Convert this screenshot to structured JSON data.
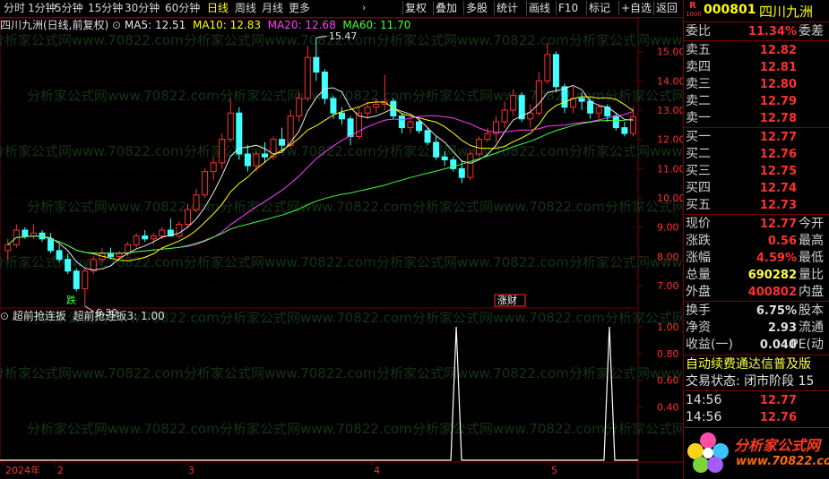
{
  "toolbar": {
    "periods": [
      "分时",
      "1分钟",
      "5分钟",
      "15分钟",
      "30分钟",
      "60分钟",
      "日线",
      "周线",
      "月线",
      "更多"
    ],
    "active_period": "日线",
    "right_buttons": [
      "复权",
      "叠加",
      "多股",
      "统计",
      "画线",
      "F10",
      "标记",
      "+自选",
      "返回"
    ]
  },
  "main": {
    "title": "四川九洲(日线,前复权)",
    "ma5": "MA5: 12.51",
    "ma10": "MA10: 12.83",
    "ma20": "MA20: 12.68",
    "ma60": "MA60: 11.70",
    "high_label": "15.47",
    "low_label": "6.30",
    "tag_die": "跌",
    "tag_zhangcai": "涨财",
    "y_ticks": [
      "15.00",
      "14.00",
      "13.00",
      "12.00",
      "11.00",
      "10.00",
      "9.00",
      "8.00",
      "7.00"
    ],
    "x_labels": [
      "2024年",
      "2",
      "3",
      "4",
      "5"
    ]
  },
  "indicator": {
    "name": "超前抢连扳",
    "value_label": "超前抢连扳3: 1.00",
    "y_ticks": [
      "1.00",
      "0.80",
      "0.60",
      "0.40"
    ]
  },
  "chart_data": [
    {
      "type": "candlestick",
      "title": "四川九洲(日线,前复权)",
      "ylim": [
        6.3,
        15.6
      ],
      "x_labels": [
        "2024年",
        "2",
        "3",
        "4",
        "5"
      ],
      "candles": [
        {
          "o": 8.2,
          "h": 8.6,
          "l": 7.9,
          "c": 8.4
        },
        {
          "o": 8.4,
          "h": 9.1,
          "l": 8.3,
          "c": 8.9
        },
        {
          "o": 8.9,
          "h": 9.0,
          "l": 8.6,
          "c": 8.7
        },
        {
          "o": 8.7,
          "h": 9.1,
          "l": 8.6,
          "c": 8.8
        },
        {
          "o": 8.8,
          "h": 8.9,
          "l": 8.5,
          "c": 8.6
        },
        {
          "o": 8.6,
          "h": 8.8,
          "l": 8.1,
          "c": 8.2
        },
        {
          "o": 8.2,
          "h": 8.4,
          "l": 7.8,
          "c": 7.9
        },
        {
          "o": 7.9,
          "h": 8.1,
          "l": 7.4,
          "c": 7.5
        },
        {
          "o": 7.5,
          "h": 7.6,
          "l": 6.8,
          "c": 6.9
        },
        {
          "o": 6.9,
          "h": 7.6,
          "l": 6.3,
          "c": 7.5
        },
        {
          "o": 7.5,
          "h": 8.0,
          "l": 7.4,
          "c": 7.9
        },
        {
          "o": 7.9,
          "h": 8.3,
          "l": 7.8,
          "c": 8.1
        },
        {
          "o": 8.1,
          "h": 8.3,
          "l": 7.9,
          "c": 8.0
        },
        {
          "o": 8.0,
          "h": 8.2,
          "l": 7.9,
          "c": 8.1
        },
        {
          "o": 8.1,
          "h": 8.5,
          "l": 8.0,
          "c": 8.4
        },
        {
          "o": 8.4,
          "h": 8.8,
          "l": 8.3,
          "c": 8.7
        },
        {
          "o": 8.7,
          "h": 8.9,
          "l": 8.5,
          "c": 8.6
        },
        {
          "o": 8.6,
          "h": 8.8,
          "l": 8.4,
          "c": 8.7
        },
        {
          "o": 8.7,
          "h": 9.0,
          "l": 8.6,
          "c": 8.9
        },
        {
          "o": 8.9,
          "h": 9.3,
          "l": 8.8,
          "c": 8.7
        },
        {
          "o": 8.7,
          "h": 9.2,
          "l": 8.6,
          "c": 9.1
        },
        {
          "o": 9.1,
          "h": 9.8,
          "l": 9.0,
          "c": 9.6
        },
        {
          "o": 9.6,
          "h": 10.3,
          "l": 9.5,
          "c": 10.1
        },
        {
          "o": 10.1,
          "h": 11.0,
          "l": 10.0,
          "c": 10.9
        },
        {
          "o": 10.9,
          "h": 11.4,
          "l": 10.6,
          "c": 11.2
        },
        {
          "o": 11.2,
          "h": 12.2,
          "l": 11.0,
          "c": 12.0
        },
        {
          "o": 12.0,
          "h": 13.4,
          "l": 11.9,
          "c": 12.9
        },
        {
          "o": 12.9,
          "h": 13.1,
          "l": 11.3,
          "c": 11.5
        },
        {
          "o": 11.5,
          "h": 11.8,
          "l": 10.9,
          "c": 11.1
        },
        {
          "o": 11.1,
          "h": 11.6,
          "l": 10.9,
          "c": 11.5
        },
        {
          "o": 11.5,
          "h": 11.9,
          "l": 11.2,
          "c": 11.4
        },
        {
          "o": 11.4,
          "h": 12.1,
          "l": 11.3,
          "c": 12.0
        },
        {
          "o": 12.0,
          "h": 12.4,
          "l": 11.6,
          "c": 11.8
        },
        {
          "o": 11.8,
          "h": 13.0,
          "l": 11.7,
          "c": 12.8
        },
        {
          "o": 12.8,
          "h": 13.6,
          "l": 12.6,
          "c": 13.4
        },
        {
          "o": 13.4,
          "h": 15.2,
          "l": 13.3,
          "c": 14.8
        },
        {
          "o": 14.8,
          "h": 15.47,
          "l": 14.0,
          "c": 14.3
        },
        {
          "o": 14.3,
          "h": 14.4,
          "l": 13.2,
          "c": 13.4
        },
        {
          "o": 13.4,
          "h": 13.5,
          "l": 12.7,
          "c": 12.9
        },
        {
          "o": 12.9,
          "h": 13.1,
          "l": 12.5,
          "c": 12.7
        },
        {
          "o": 12.7,
          "h": 12.8,
          "l": 11.8,
          "c": 12.1
        },
        {
          "o": 12.1,
          "h": 13.1,
          "l": 12.0,
          "c": 12.9
        },
        {
          "o": 12.9,
          "h": 13.3,
          "l": 12.7,
          "c": 13.1
        },
        {
          "o": 13.1,
          "h": 13.4,
          "l": 12.9,
          "c": 13.2
        },
        {
          "o": 13.2,
          "h": 14.2,
          "l": 13.0,
          "c": 13.3
        },
        {
          "o": 13.3,
          "h": 13.4,
          "l": 12.7,
          "c": 12.8
        },
        {
          "o": 12.8,
          "h": 12.9,
          "l": 12.2,
          "c": 12.4
        },
        {
          "o": 12.4,
          "h": 12.7,
          "l": 12.2,
          "c": 12.6
        },
        {
          "o": 12.6,
          "h": 12.7,
          "l": 12.2,
          "c": 12.3
        },
        {
          "o": 12.3,
          "h": 12.4,
          "l": 11.8,
          "c": 11.9
        },
        {
          "o": 11.9,
          "h": 12.1,
          "l": 11.3,
          "c": 11.4
        },
        {
          "o": 11.4,
          "h": 11.6,
          "l": 11.1,
          "c": 11.3
        },
        {
          "o": 11.3,
          "h": 11.4,
          "l": 10.9,
          "c": 11.0
        },
        {
          "o": 11.0,
          "h": 11.3,
          "l": 10.5,
          "c": 10.7
        },
        {
          "o": 10.7,
          "h": 11.6,
          "l": 10.6,
          "c": 11.5
        },
        {
          "o": 11.5,
          "h": 12.1,
          "l": 11.4,
          "c": 12.0
        },
        {
          "o": 12.0,
          "h": 12.4,
          "l": 11.9,
          "c": 12.2
        },
        {
          "o": 12.2,
          "h": 12.8,
          "l": 11.9,
          "c": 12.6
        },
        {
          "o": 12.6,
          "h": 13.3,
          "l": 12.4,
          "c": 13.0
        },
        {
          "o": 13.0,
          "h": 13.7,
          "l": 12.8,
          "c": 13.5
        },
        {
          "o": 13.5,
          "h": 13.6,
          "l": 12.6,
          "c": 12.7
        },
        {
          "o": 12.7,
          "h": 13.2,
          "l": 12.4,
          "c": 12.9
        },
        {
          "o": 12.9,
          "h": 14.3,
          "l": 12.8,
          "c": 14.0
        },
        {
          "o": 14.0,
          "h": 15.3,
          "l": 13.9,
          "c": 14.9
        },
        {
          "o": 14.9,
          "h": 15.0,
          "l": 13.6,
          "c": 13.8
        },
        {
          "o": 13.8,
          "h": 13.9,
          "l": 12.9,
          "c": 13.1
        },
        {
          "o": 13.1,
          "h": 13.8,
          "l": 12.9,
          "c": 13.4
        },
        {
          "o": 13.4,
          "h": 13.6,
          "l": 13.0,
          "c": 13.3
        },
        {
          "o": 13.3,
          "h": 13.4,
          "l": 12.7,
          "c": 12.9
        },
        {
          "o": 12.9,
          "h": 13.2,
          "l": 12.7,
          "c": 13.1
        },
        {
          "o": 13.1,
          "h": 13.2,
          "l": 12.6,
          "c": 12.8
        },
        {
          "o": 12.8,
          "h": 12.9,
          "l": 12.3,
          "c": 12.4
        },
        {
          "o": 12.4,
          "h": 12.6,
          "l": 12.1,
          "c": 12.2
        },
        {
          "o": 12.2,
          "h": 13.1,
          "l": 12.1,
          "c": 12.77
        }
      ]
    },
    {
      "type": "line",
      "title": "超前抢连扳",
      "ylim": [
        0,
        1.0
      ],
      "series": [
        {
          "name": "超前抢连扳3",
          "spikes_at_fraction": [
            0.715,
            0.955
          ],
          "value": 1.0
        }
      ]
    }
  ],
  "quote": {
    "code": "000801",
    "name": "四川九洲",
    "r_badge": "R",
    "r_sub": "1000",
    "weibi_label": "委比",
    "weibi_value": "11.34%",
    "weicha_label": "委差",
    "asks": [
      {
        "label": "卖五",
        "price": "12.82"
      },
      {
        "label": "卖四",
        "price": "12.81"
      },
      {
        "label": "卖三",
        "price": "12.80"
      },
      {
        "label": "卖二",
        "price": "12.79"
      },
      {
        "label": "卖一",
        "price": "12.78"
      }
    ],
    "bids": [
      {
        "label": "买一",
        "price": "12.77"
      },
      {
        "label": "买二",
        "price": "12.76"
      },
      {
        "label": "买三",
        "price": "12.75"
      },
      {
        "label": "买四",
        "price": "12.74"
      },
      {
        "label": "买五",
        "price": "12.73"
      }
    ],
    "stats": [
      {
        "l1": "现价",
        "v1": "12.77",
        "l2": "今开",
        "c": "#ff3030"
      },
      {
        "l1": "涨跌",
        "v1": "0.56",
        "l2": "最高",
        "c": "#ff3030"
      },
      {
        "l1": "涨幅",
        "v1": "4.59%",
        "l2": "最低",
        "c": "#ff3030"
      },
      {
        "l1": "总量",
        "v1": "690282",
        "l2": "量比",
        "c": "#ffff40"
      },
      {
        "l1": "外盘",
        "v1": "400802",
        "l2": "内盘",
        "c": "#ff3030"
      }
    ],
    "stats2": [
      {
        "l1": "换手",
        "v1": "6.75%",
        "l2": "股本"
      },
      {
        "l1": "净资",
        "v1": "2.93",
        "l2": "流通"
      },
      {
        "l1": "收益(一)",
        "v1": "0.040",
        "l2": "PE(动"
      }
    ],
    "ticker_text": "自动续费通达信普及版",
    "trade_status": "交易状态: 闭市阶段 15",
    "ticks": [
      {
        "time": "14:56",
        "price": "12.77"
      },
      {
        "time": "14:56",
        "price": "12.76"
      }
    ],
    "logo_text": "分析家公式网",
    "logo_url": "www.70822.com"
  },
  "watermark": "分析家公式网www.70822.com"
}
